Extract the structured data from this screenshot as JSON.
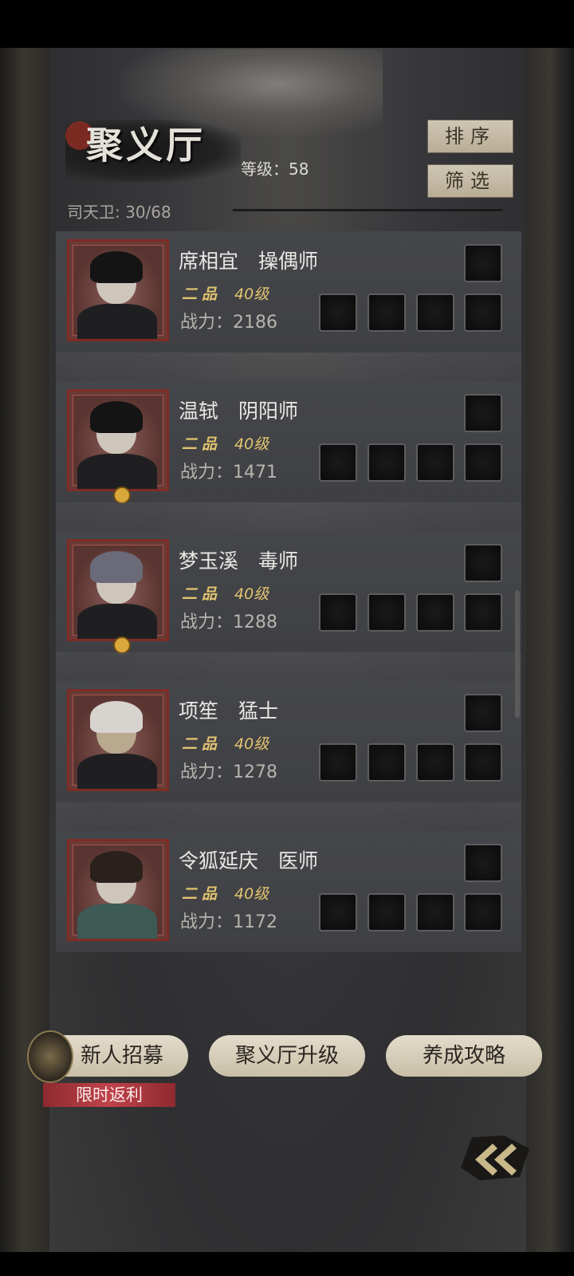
{
  "header": {
    "title": "聚义厅",
    "level_text": "等级：58",
    "count_text": "司天卫: 30/68",
    "sort_label": "排序",
    "filter_label": "筛选"
  },
  "heroes": [
    {
      "name": "席相宜　操偶师",
      "rank": "二品",
      "level": "40级",
      "power": "战力：2186",
      "emblem": false
    },
    {
      "name": "温轼　阴阳师",
      "rank": "二品",
      "level": "40级",
      "power": "战力：1471",
      "emblem": true
    },
    {
      "name": "梦玉溪　毒师",
      "rank": "二品",
      "level": "40级",
      "power": "战力：1288",
      "emblem": true
    },
    {
      "name": "项笙　猛士",
      "rank": "二品",
      "level": "40级",
      "power": "战力：1278",
      "emblem": false
    },
    {
      "name": "令狐延庆　医师",
      "rank": "二品",
      "level": "40级",
      "power": "战力：1172",
      "emblem": false
    }
  ],
  "bottom": {
    "recruit_label": "新人招募",
    "upgrade_label": "聚义厅升级",
    "guide_label": "养成攻略",
    "promo_label": "限时返利"
  },
  "icons": {
    "back": "double-chevron-left-icon",
    "recruit": "recruit-token-icon"
  }
}
